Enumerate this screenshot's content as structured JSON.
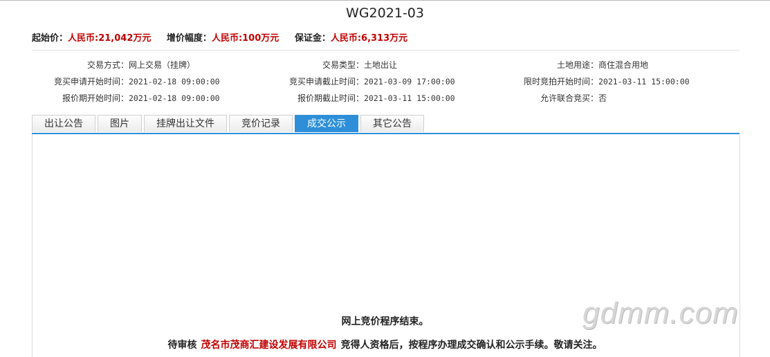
{
  "title": "WG2021-03",
  "prices": {
    "start_label": "起始价：",
    "start_value": "人民币:21,042万元",
    "increment_label": "增价幅度：",
    "increment_value": "人民币:100万元",
    "deposit_label": "保证金：",
    "deposit_value": "人民币:6,313万元"
  },
  "info": {
    "col1": [
      {
        "key": "交易方式：",
        "value": "网上交易（挂牌）"
      },
      {
        "key": "竞买申请开始时间：",
        "value": "2021-02-18 09:00:00"
      },
      {
        "key": "报价期开始时间：",
        "value": "2021-02-18 09:00:00"
      }
    ],
    "col2": [
      {
        "key": "交易类型：",
        "value": "土地出让"
      },
      {
        "key": "竞买申请截止时间：",
        "value": "2021-03-09 17:00:00"
      },
      {
        "key": "报价期截止时间：",
        "value": "2021-03-11 15:00:00"
      }
    ],
    "col3": [
      {
        "key": "土地用途：",
        "value": "商住混合用地"
      },
      {
        "key": "限时竞拍开始时间：",
        "value": "2021-03-11 15:00:00"
      },
      {
        "key": "允许联合竞买：",
        "value": "否"
      }
    ]
  },
  "tabs": [
    {
      "label": "出让公告",
      "active": false
    },
    {
      "label": "图片",
      "active": false
    },
    {
      "label": "挂牌出让文件",
      "active": false
    },
    {
      "label": "竞价记录",
      "active": false
    },
    {
      "label": "成交公示",
      "active": true
    },
    {
      "label": "其它公告",
      "active": false
    }
  ],
  "content": {
    "end_message": "网上竞价程序结束。",
    "result_prefix": "待审核",
    "company": "茂名市茂商汇建设发展有限公司",
    "result_suffix": "竞得人资格后，按程序办理成交确认和公示手续。敬请关注。"
  },
  "watermark": "gdmm.com",
  "colors": {
    "accent": "#2e8fd8",
    "highlight_red": "#c00000"
  }
}
